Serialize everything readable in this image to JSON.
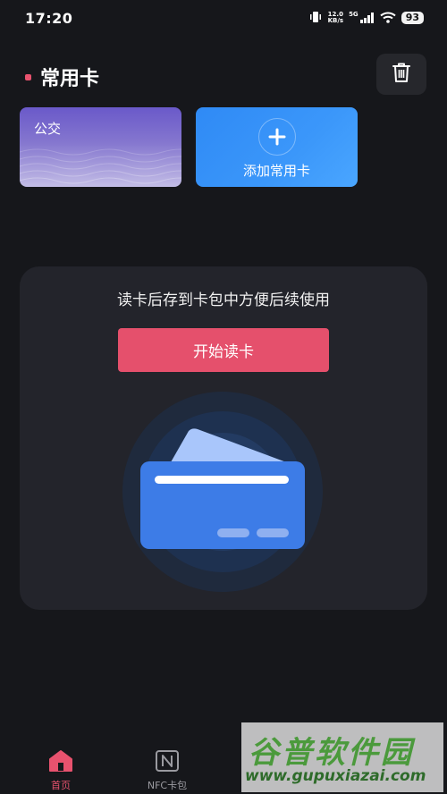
{
  "status_bar": {
    "time": "17:20",
    "net_speed_value": "12.0",
    "net_speed_unit": "KB/s",
    "network": "5G",
    "battery": "93"
  },
  "common_cards": {
    "title": "常用卡",
    "cards": [
      {
        "label": "公交"
      }
    ],
    "add_label": "添加常用卡"
  },
  "read_section": {
    "description": "读卡后存到卡包中方便后续使用",
    "button_label": "开始读卡"
  },
  "bottom_nav": {
    "items": [
      {
        "label": "首页",
        "icon": "home-icon",
        "active": true
      },
      {
        "label": "NFC卡包",
        "icon": "nfc-icon",
        "active": false
      }
    ]
  },
  "watermark": {
    "brand": "谷普软件园",
    "url": "www.gupuxiazai.com"
  },
  "colors": {
    "background": "#16171b",
    "accent": "#e5506c",
    "card_blue": "#3b97fa",
    "card_purple": "#6a59c9"
  }
}
